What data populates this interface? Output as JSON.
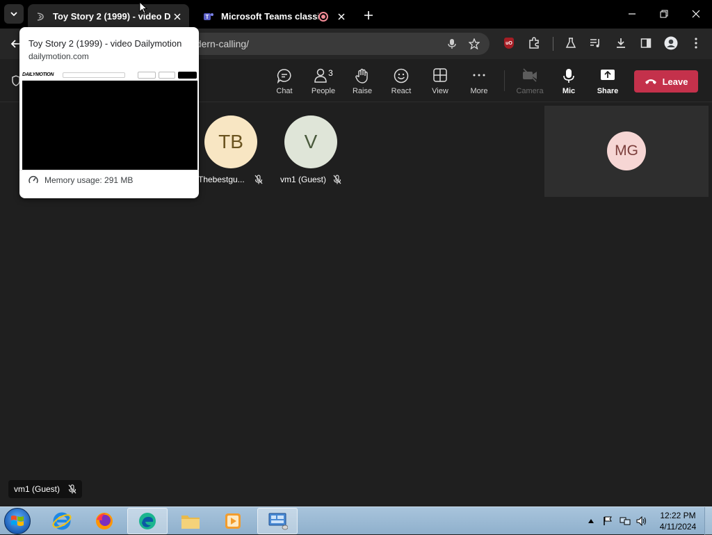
{
  "browser": {
    "tabs": [
      {
        "title": "Toy Story 2 (1999) - video Dailymotion",
        "active": true
      },
      {
        "title": "Microsoft Teams classic",
        "active": false,
        "recording": true
      }
    ],
    "address": "odern-calling/"
  },
  "hover_card": {
    "title": "Toy Story 2 (1999) - video Dailymotion",
    "domain": "dailymotion.com",
    "thumb_logo": "DAILYMOTION",
    "memory": "Memory usage: 291 MB"
  },
  "meeting_bar": {
    "chat": "Chat",
    "people": "People",
    "people_count": "3",
    "raise": "Raise",
    "react": "React",
    "view": "View",
    "more": "More",
    "camera": "Camera",
    "mic": "Mic",
    "share": "Share",
    "leave": "Leave"
  },
  "participants": [
    {
      "initials": "TB",
      "name": "Thebestgu...",
      "avatar_color": "#f8e6c3"
    },
    {
      "initials": "V",
      "name": "vm1 (Guest)",
      "avatar_color": "#dfe5d8"
    }
  ],
  "side_tile": {
    "initials": "MG"
  },
  "self_label": "vm1 (Guest)",
  "taskbar": {
    "clock_time": "12:22 PM",
    "clock_date": "4/11/2024"
  },
  "colors": {
    "leave": "#c4314b",
    "recording": "#f28b96"
  }
}
